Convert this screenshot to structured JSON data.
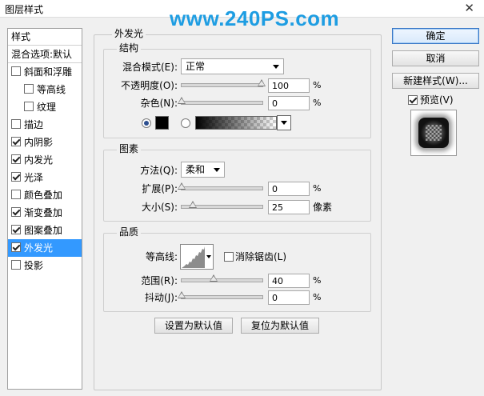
{
  "window": {
    "title": "图层样式",
    "close_glyph": "✕"
  },
  "watermark": {
    "text": "www.240PS.com",
    "color": "#1e9de2"
  },
  "sidebar": {
    "header": "样式",
    "blend_options": "混合选项:默认",
    "items": [
      {
        "label": "斜面和浮雕",
        "checked": false,
        "sub": false,
        "selected": false
      },
      {
        "label": "等高线",
        "checked": false,
        "sub": true,
        "selected": false
      },
      {
        "label": "纹理",
        "checked": false,
        "sub": true,
        "selected": false
      },
      {
        "label": "描边",
        "checked": false,
        "sub": false,
        "selected": false
      },
      {
        "label": "内阴影",
        "checked": true,
        "sub": false,
        "selected": false
      },
      {
        "label": "内发光",
        "checked": true,
        "sub": false,
        "selected": false
      },
      {
        "label": "光泽",
        "checked": true,
        "sub": false,
        "selected": false
      },
      {
        "label": "颜色叠加",
        "checked": false,
        "sub": false,
        "selected": false
      },
      {
        "label": "渐变叠加",
        "checked": true,
        "sub": false,
        "selected": false
      },
      {
        "label": "图案叠加",
        "checked": true,
        "sub": false,
        "selected": false
      },
      {
        "label": "外发光",
        "checked": true,
        "sub": false,
        "selected": true
      },
      {
        "label": "投影",
        "checked": false,
        "sub": false,
        "selected": false
      }
    ],
    "selected_color": "#3399ff"
  },
  "panel": {
    "title": "外发光",
    "structure": {
      "legend": "结构",
      "blend_mode_label": "混合模式(E):",
      "blend_mode_value": "正常",
      "opacity_label": "不透明度(O):",
      "opacity_value": "100",
      "opacity_unit": "%",
      "noise_label": "杂色(N):",
      "noise_value": "0",
      "noise_unit": "%",
      "color_radio_selected": true,
      "gradient_radio_selected": false,
      "glow_color": "#000000"
    },
    "elements": {
      "legend": "图素",
      "method_label": "方法(Q):",
      "method_value": "柔和",
      "spread_label": "扩展(P):",
      "spread_value": "0",
      "spread_unit": "%",
      "size_label": "大小(S):",
      "size_value": "25",
      "size_unit": "像素"
    },
    "quality": {
      "legend": "品质",
      "contour_label": "等高线:",
      "antialias_label": "消除锯齿(L)",
      "antialias_checked": false,
      "range_label": "范围(R):",
      "range_value": "40",
      "range_unit": "%",
      "jitter_label": "抖动(J):",
      "jitter_value": "0",
      "jitter_unit": "%"
    },
    "make_default": "设置为默认值",
    "reset_default": "复位为默认值"
  },
  "buttons": {
    "ok": "确定",
    "cancel": "取消",
    "new_style": "新建样式(W)..."
  },
  "preview": {
    "label": "预览(V)",
    "checked": true
  }
}
